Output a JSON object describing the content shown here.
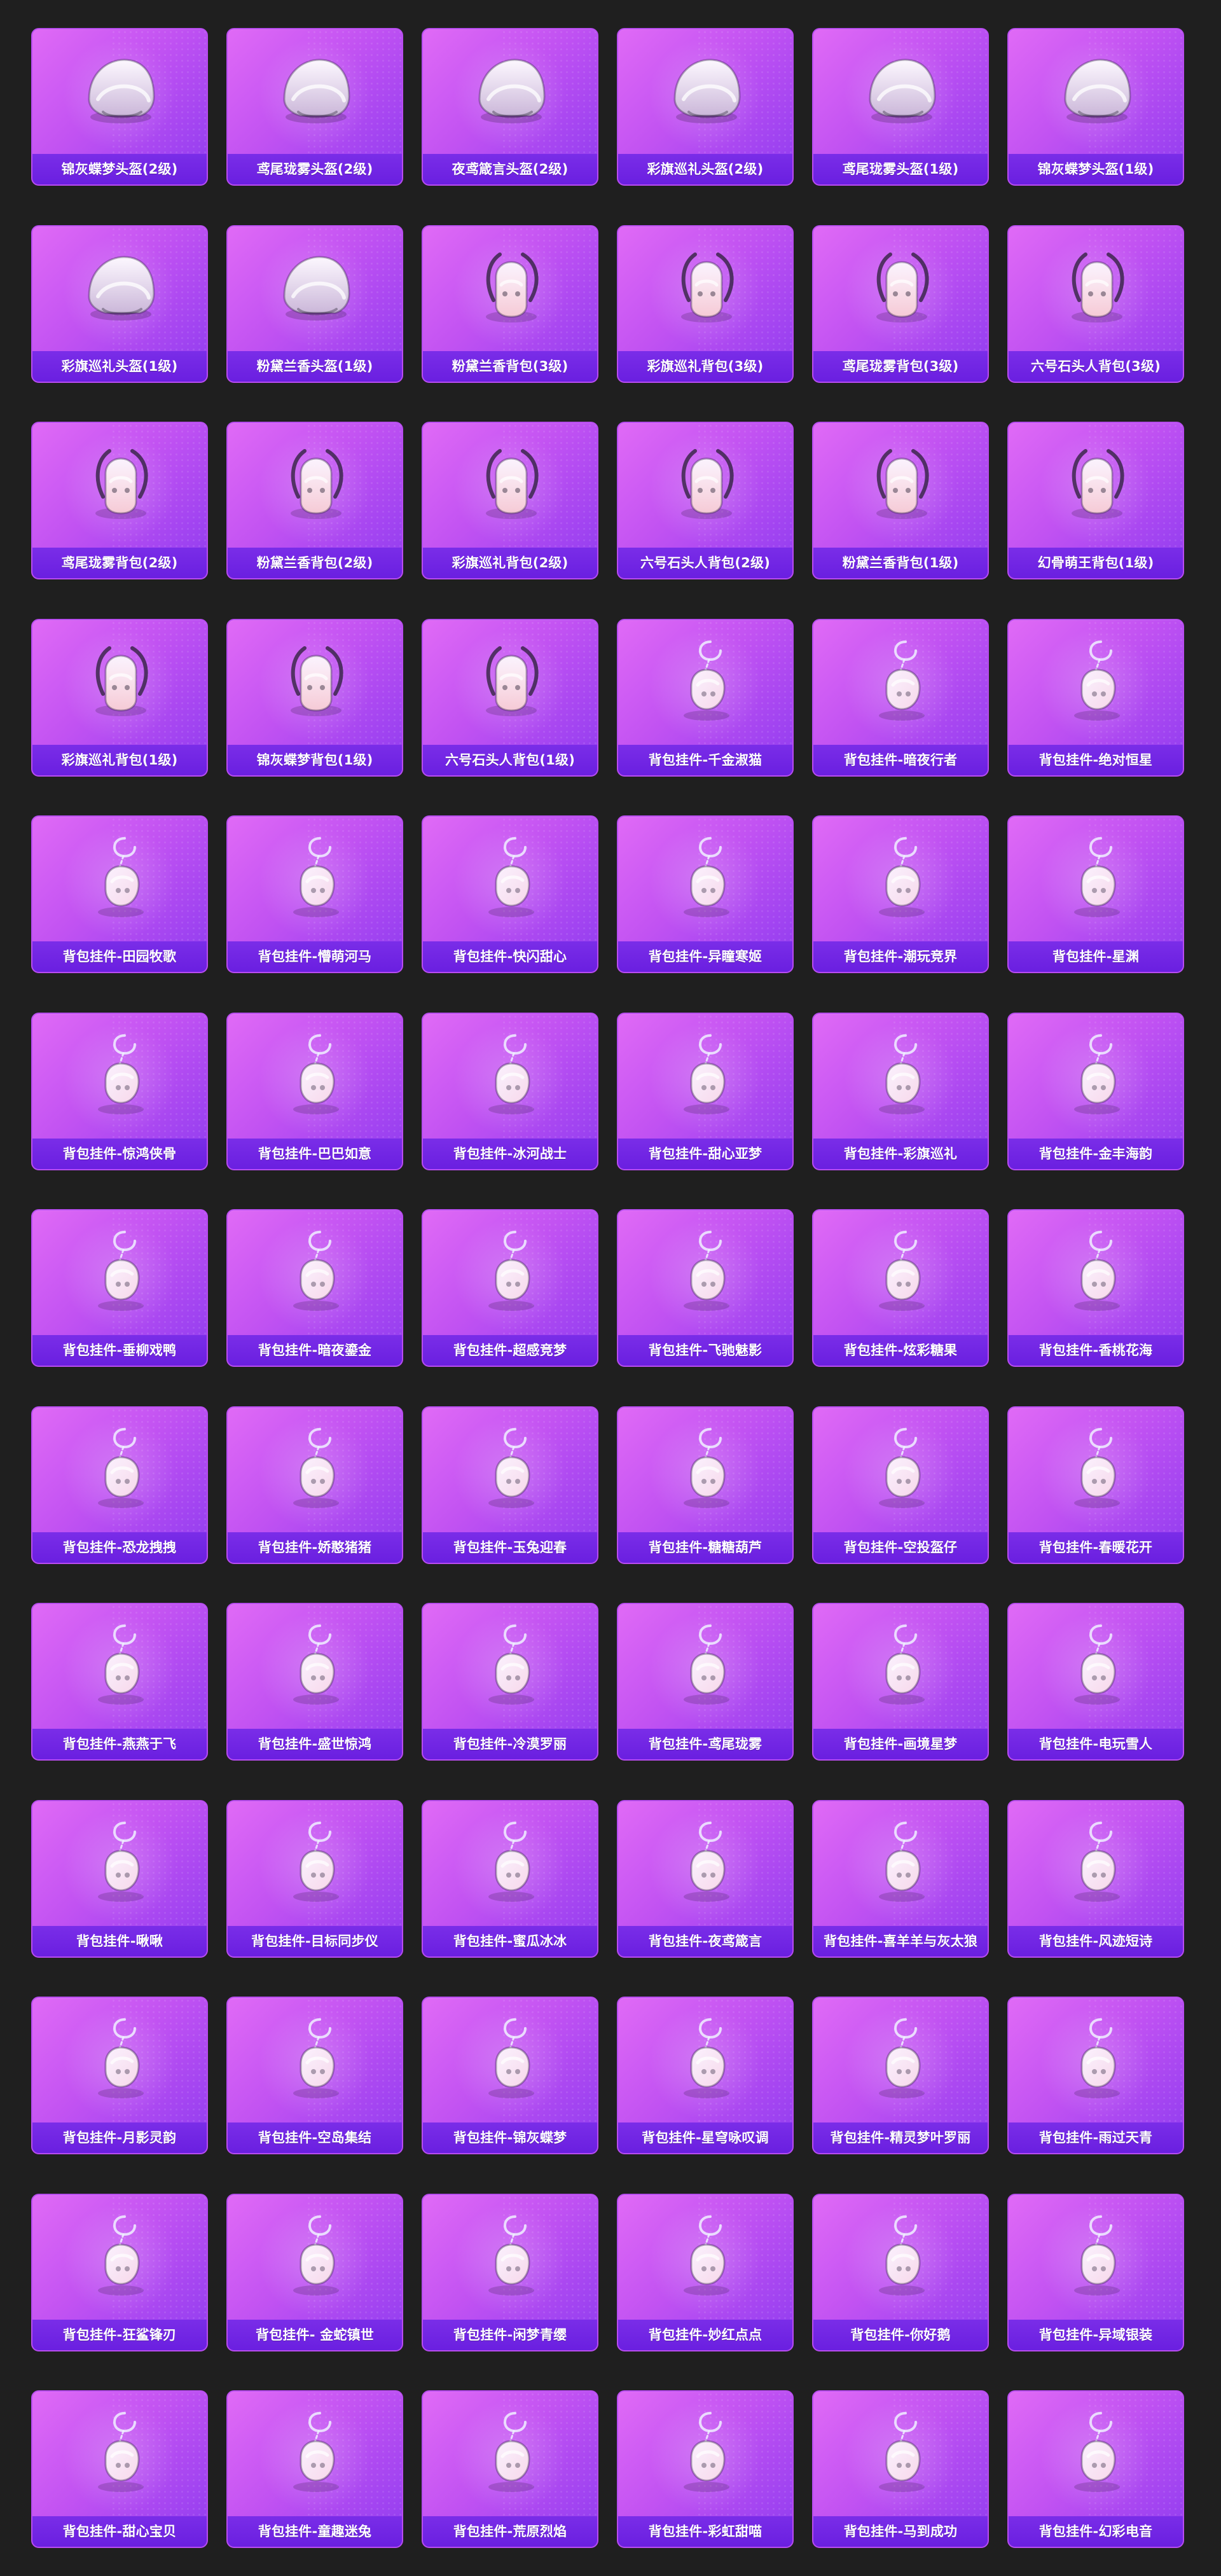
{
  "items": [
    {
      "label": "锦灰蝶梦头盔(2级)",
      "icon": "helmet-icon",
      "kind": "helmet",
      "tint": "#cbb7d9"
    },
    {
      "label": "鸢尾珑雾头盔(2级)",
      "icon": "helmet-icon",
      "kind": "helmet",
      "tint": "#e9e4f0"
    },
    {
      "label": "夜鸢箴言头盔(2级)",
      "icon": "helmet-icon",
      "kind": "helmet",
      "tint": "#d7e7e4"
    },
    {
      "label": "彩旗巡礼头盔(2级)",
      "icon": "helmet-icon",
      "kind": "helmet",
      "tint": "#f2f2f6"
    },
    {
      "label": "鸢尾珑雾头盔(1级)",
      "icon": "helmet-icon",
      "kind": "helmet",
      "tint": "#e7e0ef"
    },
    {
      "label": "锦灰蝶梦头盔(1级)",
      "icon": "helmet-icon",
      "kind": "helmet",
      "tint": "#d7c6e5"
    },
    {
      "label": "彩旗巡礼头盔(1级)",
      "icon": "helmet-icon",
      "kind": "helmet",
      "tint": "#eef0f6"
    },
    {
      "label": "粉黛兰香头盔(1级)",
      "icon": "helmet-icon",
      "kind": "helmet",
      "tint": "#f3d3dc"
    },
    {
      "label": "粉黛兰香背包(3级)",
      "icon": "backpack-icon",
      "kind": "backpack",
      "tint": "#f6cad6"
    },
    {
      "label": "彩旗巡礼背包(3级)",
      "icon": "backpack-icon",
      "kind": "backpack",
      "tint": "#f2f2f6"
    },
    {
      "label": "鸢尾珑雾背包(3级)",
      "icon": "backpack-icon",
      "kind": "backpack",
      "tint": "#e6def0"
    },
    {
      "label": "六号石头人背包(3级)",
      "icon": "backpack-icon",
      "kind": "backpack",
      "tint": "#8f967f"
    },
    {
      "label": "鸢尾珑雾背包(2级)",
      "icon": "backpack-icon",
      "kind": "backpack",
      "tint": "#e6e1f0"
    },
    {
      "label": "粉黛兰香背包(2级)",
      "icon": "backpack-icon",
      "kind": "backpack",
      "tint": "#f6cad6"
    },
    {
      "label": "彩旗巡礼背包(2级)",
      "icon": "backpack-icon",
      "kind": "backpack",
      "tint": "#f2f2f6"
    },
    {
      "label": "六号石头人背包(2级)",
      "icon": "backpack-icon",
      "kind": "backpack",
      "tint": "#8d947d"
    },
    {
      "label": "粉黛兰香背包(1级)",
      "icon": "backpack-icon",
      "kind": "backpack",
      "tint": "#f6cad6"
    },
    {
      "label": "幻骨萌王背包(1级)",
      "icon": "backpack-icon",
      "kind": "backpack",
      "tint": "#f7f7fb"
    },
    {
      "label": "彩旗巡礼背包(1级)",
      "icon": "backpack-icon",
      "kind": "backpack",
      "tint": "#f2f2f6"
    },
    {
      "label": "锦灰蝶梦背包(1级)",
      "icon": "backpack-icon",
      "kind": "backpack",
      "tint": "#b9a1d0"
    },
    {
      "label": "六号石头人背包(1级)",
      "icon": "backpack-icon",
      "kind": "backpack",
      "tint": "#828b74"
    },
    {
      "label": "背包挂件-千金淑猫",
      "icon": "charm-icon",
      "kind": "charm",
      "tint": "#f7d7ea"
    },
    {
      "label": "背包挂件-暗夜行者",
      "icon": "charm-icon",
      "kind": "charm",
      "tint": "#2a2a2a"
    },
    {
      "label": "背包挂件-绝对恒星",
      "icon": "charm-icon",
      "kind": "charm",
      "tint": "#f2a2c7"
    },
    {
      "label": "背包挂件-田园牧歌",
      "icon": "charm-icon",
      "kind": "charm",
      "tint": "#f1f2f7"
    },
    {
      "label": "背包挂件-懵萌河马",
      "icon": "charm-icon",
      "kind": "charm",
      "tint": "#f0d8a6"
    },
    {
      "label": "背包挂件-快闪甜心",
      "icon": "charm-icon",
      "kind": "charm",
      "tint": "#f5b7d4"
    },
    {
      "label": "背包挂件-异瞳寒姬",
      "icon": "charm-icon",
      "kind": "charm",
      "tint": "#a8d6e6"
    },
    {
      "label": "背包挂件-潮玩竞界",
      "icon": "charm-icon",
      "kind": "charm",
      "tint": "#ffffff"
    },
    {
      "label": "背包挂件-星渊",
      "icon": "charm-icon",
      "kind": "charm",
      "tint": "#c9c7d8"
    },
    {
      "label": "背包挂件-惊鸿侠骨",
      "icon": "charm-icon",
      "kind": "charm",
      "tint": "#c92d39"
    },
    {
      "label": "背包挂件-巴巴如意",
      "icon": "charm-icon",
      "kind": "charm",
      "tint": "#f2d5e8"
    },
    {
      "label": "背包挂件-冰河战士",
      "icon": "charm-icon",
      "kind": "charm",
      "tint": "#7fb6ff"
    },
    {
      "label": "背包挂件-甜心亚梦",
      "icon": "charm-icon",
      "kind": "charm",
      "tint": "#2a2a2a"
    },
    {
      "label": "背包挂件-彩旗巡礼",
      "icon": "charm-icon",
      "kind": "charm",
      "tint": "#f7e7d3"
    },
    {
      "label": "背包挂件-金丰海韵",
      "icon": "charm-icon",
      "kind": "charm",
      "tint": "#dfe4f3"
    },
    {
      "label": "背包挂件-垂柳戏鸭",
      "icon": "charm-icon",
      "kind": "charm",
      "tint": "#f4c55b"
    },
    {
      "label": "背包挂件-暗夜鎏金",
      "icon": "charm-icon",
      "kind": "charm",
      "tint": "#2f2a28"
    },
    {
      "label": "背包挂件-超感竞梦",
      "icon": "charm-icon",
      "kind": "charm",
      "tint": "#79d5e6"
    },
    {
      "label": "背包挂件-飞驰魅影",
      "icon": "charm-icon",
      "kind": "charm",
      "tint": "#8ad7ff"
    },
    {
      "label": "背包挂件-炫彩糖果",
      "icon": "charm-icon",
      "kind": "charm",
      "tint": "#f080c9"
    },
    {
      "label": "背包挂件-香桃花海",
      "icon": "charm-icon",
      "kind": "charm",
      "tint": "#f6a7c3"
    },
    {
      "label": "背包挂件-恐龙拽拽",
      "icon": "charm-icon",
      "kind": "charm",
      "tint": "#9ad07c"
    },
    {
      "label": "背包挂件-娇憨猪猪",
      "icon": "charm-icon",
      "kind": "charm",
      "tint": "#f6d2e1"
    },
    {
      "label": "背包挂件-玉兔迎春",
      "icon": "charm-icon",
      "kind": "charm",
      "tint": "#f1e2d7"
    },
    {
      "label": "背包挂件-糖糖葫芦",
      "icon": "charm-icon",
      "kind": "charm",
      "tint": "#c61f2c"
    },
    {
      "label": "背包挂件-空投盔仔",
      "icon": "charm-icon",
      "kind": "charm",
      "tint": "#e24b4b"
    },
    {
      "label": "背包挂件-春暖花开",
      "icon": "charm-icon",
      "kind": "charm",
      "tint": "#f2b4d2"
    },
    {
      "label": "背包挂件-燕燕于飞",
      "icon": "charm-icon",
      "kind": "charm",
      "tint": "#d8a64b"
    },
    {
      "label": "背包挂件-盛世惊鸿",
      "icon": "charm-icon",
      "kind": "charm",
      "tint": "#f7c2da"
    },
    {
      "label": "背包挂件-冷漠罗丽",
      "icon": "charm-icon",
      "kind": "charm",
      "tint": "#f3c6db"
    },
    {
      "label": "背包挂件-鸢尾珑雾",
      "icon": "charm-icon",
      "kind": "charm",
      "tint": "#d7d6e6"
    },
    {
      "label": "背包挂件-画境星梦",
      "icon": "charm-icon",
      "kind": "charm",
      "tint": "#d6a55e"
    },
    {
      "label": "背包挂件-电玩雪人",
      "icon": "charm-icon",
      "kind": "charm",
      "tint": "#72bdf5"
    },
    {
      "label": "背包挂件-啾啾",
      "icon": "charm-icon",
      "kind": "charm",
      "tint": "#f1a3c3"
    },
    {
      "label": "背包挂件-目标同步仪",
      "icon": "charm-icon",
      "kind": "charm",
      "tint": "#d7e6ff"
    },
    {
      "label": "背包挂件-蜜瓜冰冰",
      "icon": "charm-icon",
      "kind": "charm",
      "tint": "#dff27a"
    },
    {
      "label": "背包挂件-夜鸢箴言",
      "icon": "charm-icon",
      "kind": "charm",
      "tint": "#5aa8d5"
    },
    {
      "label": "背包挂件-喜羊羊与灰太狼",
      "icon": "charm-icon",
      "kind": "charm",
      "tint": "#f6a1c2"
    },
    {
      "label": "背包挂件-风迹短诗",
      "icon": "charm-icon",
      "kind": "charm",
      "tint": "#e4eef6"
    },
    {
      "label": "背包挂件-月影灵韵",
      "icon": "charm-icon",
      "kind": "charm",
      "tint": "#b8c2f0"
    },
    {
      "label": "背包挂件-空岛集结",
      "icon": "charm-icon",
      "kind": "charm",
      "tint": "#d6662c"
    },
    {
      "label": "背包挂件-锦灰蝶梦",
      "icon": "charm-icon",
      "kind": "charm",
      "tint": "#b9a1d0"
    },
    {
      "label": "背包挂件-星穹咏叹调",
      "icon": "charm-icon",
      "kind": "charm",
      "tint": "#f0c5a0"
    },
    {
      "label": "背包挂件-精灵梦叶罗丽",
      "icon": "charm-icon",
      "kind": "charm",
      "tint": "#f59ac3"
    },
    {
      "label": "背包挂件-雨过天青",
      "icon": "charm-icon",
      "kind": "charm",
      "tint": "#dfe6f2"
    },
    {
      "label": "背包挂件-狂鲨锋刃",
      "icon": "charm-icon",
      "kind": "charm",
      "tint": "#d8b25d"
    },
    {
      "label": "背包挂件- 金蛇镇世",
      "icon": "charm-icon",
      "kind": "charm",
      "tint": "#d7a54c"
    },
    {
      "label": "背包挂件-闲梦青缨",
      "icon": "charm-icon",
      "kind": "charm",
      "tint": "#e3c06b"
    },
    {
      "label": "背包挂件-妙红点点",
      "icon": "charm-icon",
      "kind": "charm",
      "tint": "#ffffff"
    },
    {
      "label": "背包挂件-你好鹅",
      "icon": "charm-icon",
      "kind": "charm",
      "tint": "#2a2a2a"
    },
    {
      "label": "背包挂件-异域银装",
      "icon": "charm-icon",
      "kind": "charm",
      "tint": "#d7dbe6"
    },
    {
      "label": "背包挂件-甜心宝贝",
      "icon": "charm-icon",
      "kind": "charm",
      "tint": "#e14a5b"
    },
    {
      "label": "背包挂件-童趣迷兔",
      "icon": "charm-icon",
      "kind": "charm",
      "tint": "#b2313f"
    },
    {
      "label": "背包挂件-荒原烈焰",
      "icon": "charm-icon",
      "kind": "charm",
      "tint": "#d8b05a"
    },
    {
      "label": "背包挂件-彩虹甜喵",
      "icon": "charm-icon",
      "kind": "charm",
      "tint": "#f7d5e8"
    },
    {
      "label": "背包挂件-马到成功",
      "icon": "charm-icon",
      "kind": "charm",
      "tint": "#f0c86a"
    },
    {
      "label": "背包挂件-幻彩电音",
      "icon": "charm-icon",
      "kind": "charm",
      "tint": "#a9e3f2"
    }
  ]
}
